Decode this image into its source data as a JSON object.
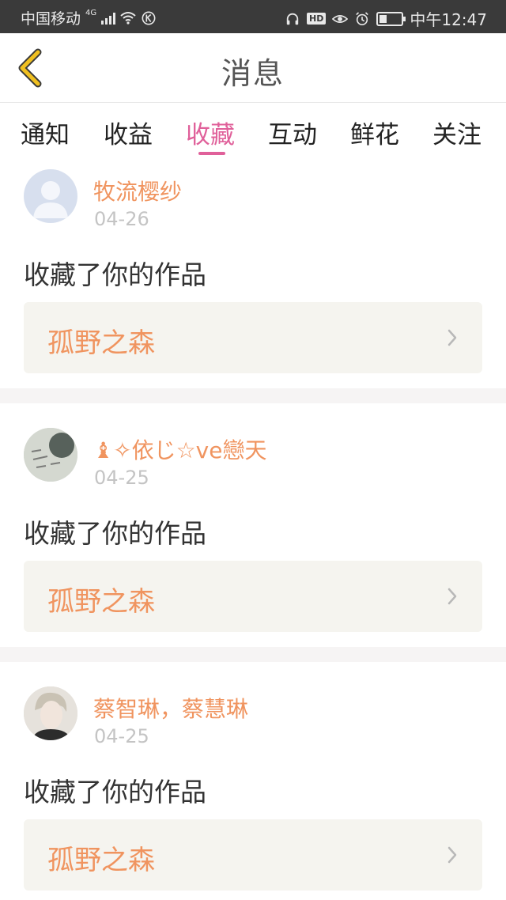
{
  "status_bar": {
    "carrier": "中国移动",
    "network": "4G",
    "time": "中午12:47",
    "battery_level": 0.35
  },
  "header": {
    "title": "消息",
    "back_icon": "chevron-left-icon",
    "accent_color": "#f0c020"
  },
  "tabs": [
    {
      "label": "通知",
      "active": false
    },
    {
      "label": "收益",
      "active": false
    },
    {
      "label": "收藏",
      "active": true
    },
    {
      "label": "互动",
      "active": false
    },
    {
      "label": "鲜花",
      "active": false
    },
    {
      "label": "关注",
      "active": false
    }
  ],
  "colors": {
    "tab_active": "#e0609a",
    "username": "#f0945f",
    "work_title": "#f0945f",
    "date": "#c4c4c4"
  },
  "messages": [
    {
      "user": "牧流樱纱",
      "date": "04-26",
      "action": "收藏了你的作品",
      "work": "孤野之森",
      "avatar": "default-avatar-icon"
    },
    {
      "user": "♝✧依じ☆ve戀天",
      "date": "04-25",
      "action": "收藏了你的作品",
      "work": "孤野之森",
      "avatar": "calligraphy-avatar-icon"
    },
    {
      "user": "蔡智琳，蔡慧琳",
      "date": "04-25",
      "action": "收藏了你的作品",
      "work": "孤野之森",
      "avatar": "portrait-avatar-icon"
    }
  ]
}
